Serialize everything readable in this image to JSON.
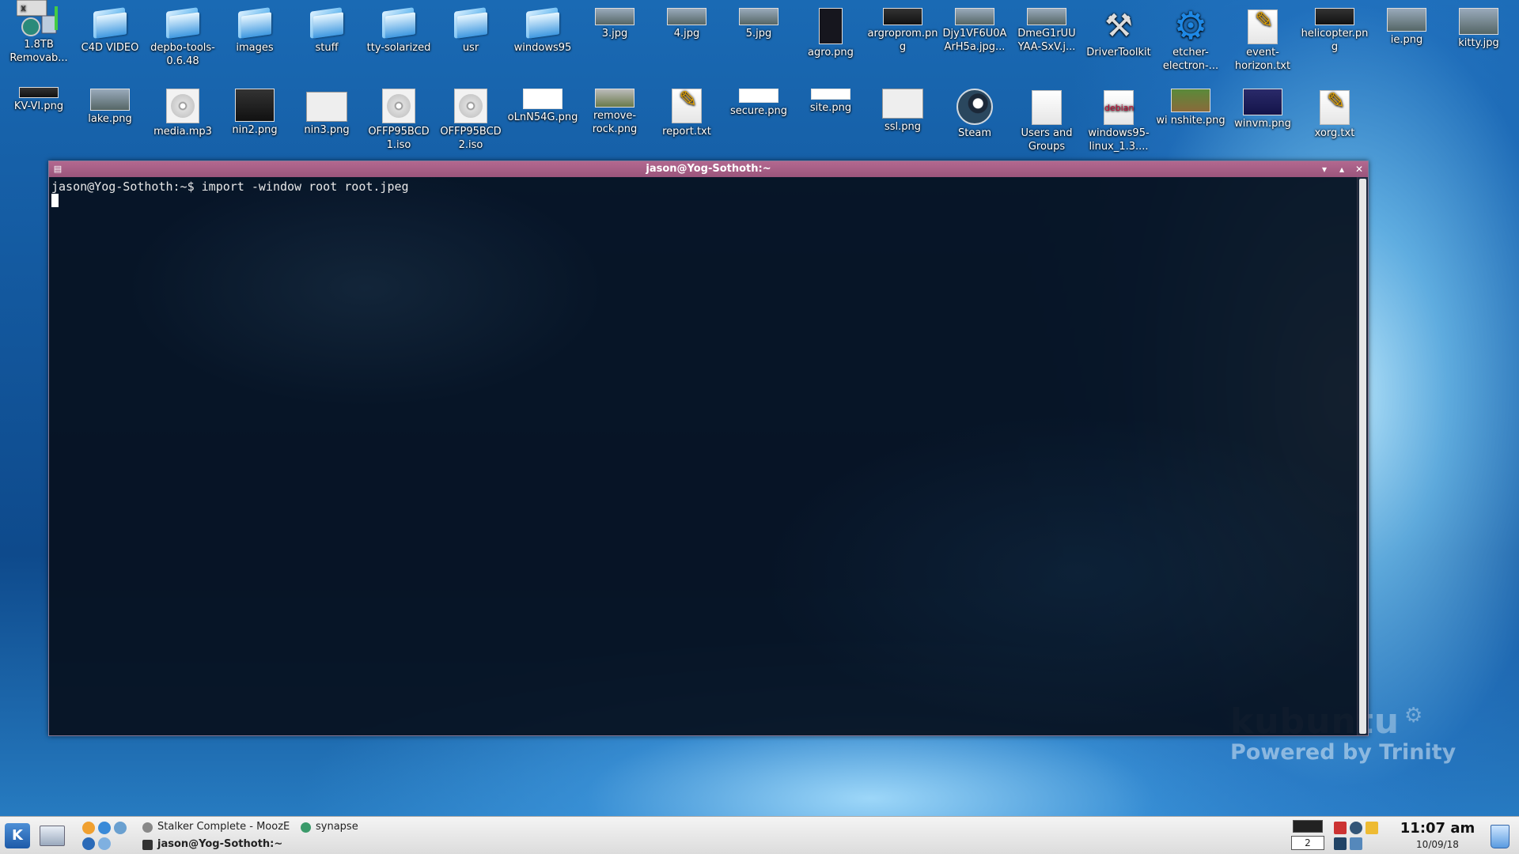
{
  "desktop": {
    "icons": [
      {
        "label": "1.8TB Removab...",
        "icon": "removable-drive-icon"
      },
      {
        "label": "C4D VIDEO",
        "icon": "folder-icon"
      },
      {
        "label": "depbo-tools-0.6.48",
        "icon": "folder-icon"
      },
      {
        "label": "images",
        "icon": "folder-icon"
      },
      {
        "label": "stuff",
        "icon": "folder-icon"
      },
      {
        "label": "tty-solarized",
        "icon": "folder-icon"
      },
      {
        "label": "usr",
        "icon": "folder-icon"
      },
      {
        "label": "windows95",
        "icon": "folder-icon"
      },
      {
        "label": "3.jpg",
        "icon": "image-thumbnail-icon"
      },
      {
        "label": "4.jpg",
        "icon": "image-thumbnail-icon"
      },
      {
        "label": "5.jpg",
        "icon": "image-thumbnail-icon"
      },
      {
        "label": "agro.png",
        "icon": "image-thumbnail-icon"
      },
      {
        "label": "argroprom.png",
        "icon": "image-thumbnail-icon"
      },
      {
        "label": "Djy1VF6U0A ArH5a.jpg...",
        "icon": "image-thumbnail-icon"
      },
      {
        "label": "DmeG1rUU YAA-SxV.j...",
        "icon": "image-thumbnail-icon"
      },
      {
        "label": "DriverToolkit",
        "icon": "tools-icon"
      },
      {
        "label": "etcher-electron-...",
        "icon": "gear-icon"
      },
      {
        "label": "event-horizon.txt",
        "icon": "text-file-icon"
      },
      {
        "label": "helicopter.png",
        "icon": "image-thumbnail-icon"
      },
      {
        "label": "ie.png",
        "icon": "image-thumbnail-icon"
      },
      {
        "label": "kitty.jpg",
        "icon": "image-thumbnail-icon"
      },
      {
        "label": "KV-VI.png",
        "icon": "image-thumbnail-icon"
      },
      {
        "label": "lake.png",
        "icon": "image-thumbnail-icon"
      },
      {
        "label": "media.mp3",
        "icon": "audio-file-icon"
      },
      {
        "label": "nin2.png",
        "icon": "image-thumbnail-icon"
      },
      {
        "label": "nin3.png",
        "icon": "image-thumbnail-icon"
      },
      {
        "label": "OFFP95BCD 1.iso",
        "icon": "disc-image-icon"
      },
      {
        "label": "OFFP95BCD 2.iso",
        "icon": "disc-image-icon"
      },
      {
        "label": "oLnN54G.png",
        "icon": "image-thumbnail-icon"
      },
      {
        "label": "remove-rock.png",
        "icon": "image-thumbnail-icon"
      },
      {
        "label": "report.txt",
        "icon": "text-file-icon"
      },
      {
        "label": "secure.png",
        "icon": "image-thumbnail-icon"
      },
      {
        "label": "site.png",
        "icon": "image-thumbnail-icon"
      },
      {
        "label": "ssl.png",
        "icon": "image-thumbnail-icon"
      },
      {
        "label": "Steam",
        "icon": "steam-icon"
      },
      {
        "label": "Users and Groups",
        "icon": "users-groups-icon"
      },
      {
        "label": "windows95-linux_1.3....",
        "icon": "debian-package-icon"
      },
      {
        "label": "wi nshite.png",
        "icon": "image-thumbnail-icon"
      },
      {
        "label": "winvm.png",
        "icon": "image-thumbnail-icon"
      },
      {
        "label": "xorg.txt",
        "icon": "text-file-icon"
      }
    ],
    "wallpaper_brand": "kubuntu",
    "wallpaper_tagline": "Powered by Trinity"
  },
  "terminal": {
    "title": "jason@Yog-Sothoth:~",
    "prompt": "jason@Yog-Sothoth:~$ ",
    "command": "import -window root root.jpeg",
    "title_color": "#a85e87"
  },
  "taskbar": {
    "tasks": [
      {
        "label": "Stalker Complete - MoozE",
        "icon": "browser-icon"
      },
      {
        "label": "synapse",
        "icon": "synapse-icon"
      },
      {
        "label": "jason@Yog-Sothoth:~",
        "icon": "terminal-icon"
      }
    ],
    "pager_current": "2",
    "clock_time": "11:07 am",
    "clock_date": "10/09/18"
  }
}
